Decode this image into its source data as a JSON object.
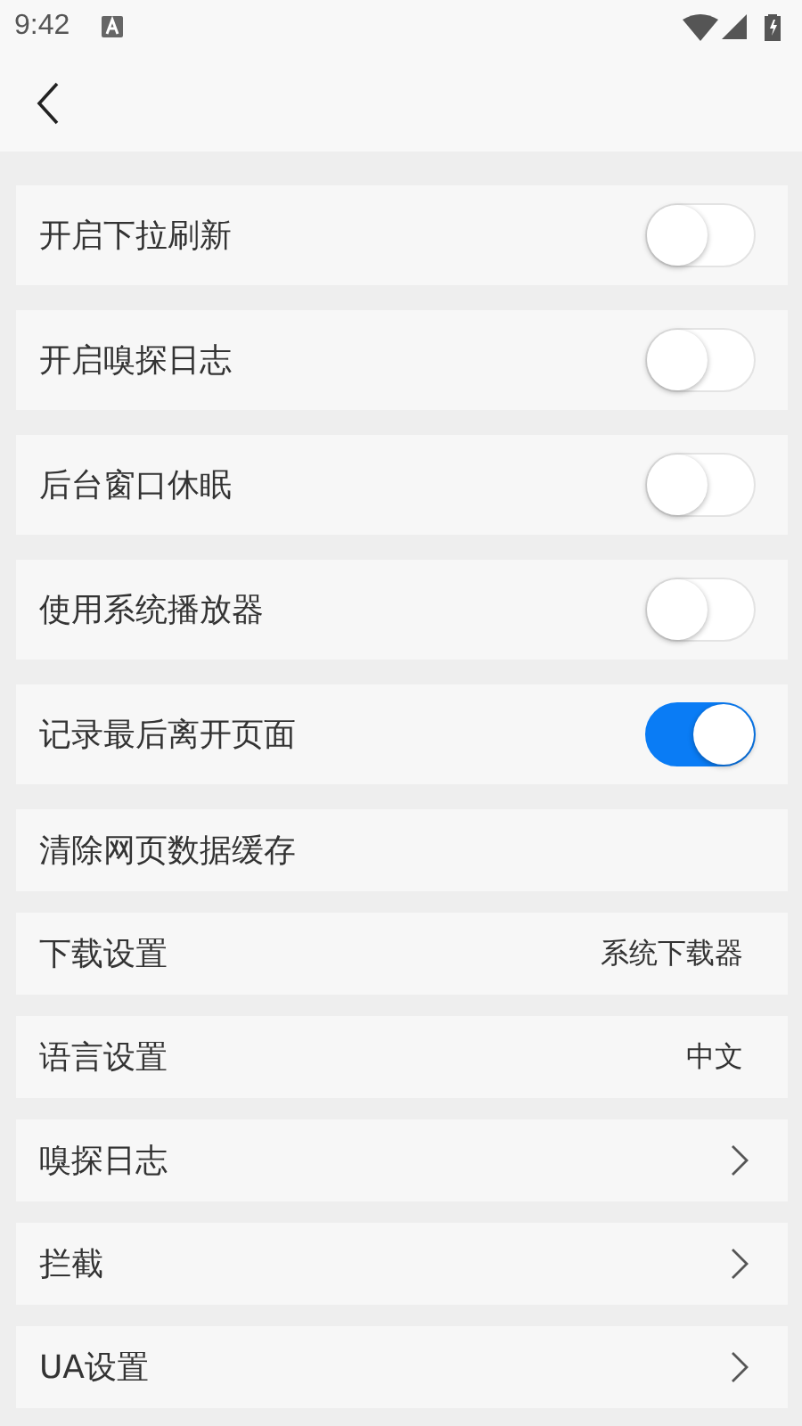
{
  "status_bar": {
    "time": "9:42"
  },
  "items": [
    {
      "kind": "toggle",
      "label": "开启下拉刷新",
      "on": false
    },
    {
      "kind": "toggle",
      "label": "开启嗅探日志",
      "on": false
    },
    {
      "kind": "toggle",
      "label": "后台窗口休眠",
      "on": false
    },
    {
      "kind": "toggle",
      "label": "使用系统播放器",
      "on": false
    },
    {
      "kind": "toggle",
      "label": "记录最后离开页面",
      "on": true
    },
    {
      "kind": "plain",
      "label": "清除网页数据缓存"
    },
    {
      "kind": "value",
      "label": "下载设置",
      "value": "系统下载器"
    },
    {
      "kind": "value",
      "label": "语言设置",
      "value": "中文"
    },
    {
      "kind": "link",
      "label": "嗅探日志"
    },
    {
      "kind": "link",
      "label": "拦截"
    },
    {
      "kind": "link",
      "label": "UA设置"
    }
  ]
}
